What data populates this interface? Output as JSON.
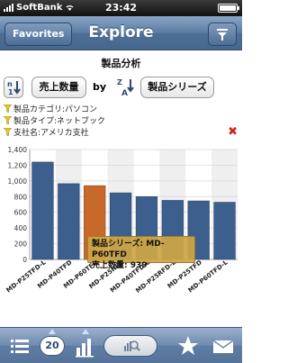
{
  "status_bar": {
    "carrier": "SoftBank",
    "time": "23:42"
  },
  "nav": {
    "back_label": "Favorites",
    "title": "Explore",
    "filter_icon": "filter-icon"
  },
  "heading": "製品分析",
  "sort": {
    "measure_label": "売上数量",
    "by_label": "by",
    "dimension_label": "製品シリーズ"
  },
  "filters": [
    {
      "label": "製品カテゴリ:パソコン"
    },
    {
      "label": "製品タイプ:ネットブック"
    },
    {
      "label": "支社名:アメリカ支社"
    }
  ],
  "tooltip": {
    "series_label": "製品シリーズ: MD-P60TFD",
    "qty_label": "売上数量: 939"
  },
  "toolbar": {
    "count": "20"
  },
  "colors": {
    "bar": "#3d5f8e",
    "highlight": "#c8692c",
    "nav": "#5a7ca3",
    "filter": "#e6c12a"
  },
  "chart_data": {
    "type": "bar",
    "categories": [
      "MD-P25TFD-L",
      "MD-P40TFD",
      "MD-P60TFD",
      "MD-P25RFD",
      "MD-P40TFD-L",
      "MD-P25RFD-L",
      "MD-P25TFD",
      "MD-P60TFD-L"
    ],
    "values": [
      1240,
      965,
      939,
      848,
      800,
      752,
      745,
      728
    ],
    "highlight_index": 2,
    "ylim": [
      0,
      1400
    ],
    "yticks": [
      "0",
      "200",
      "400",
      "600",
      "800",
      "1,000",
      "1,200",
      "1,400"
    ],
    "ytick_values": [
      0,
      200,
      400,
      600,
      800,
      1000,
      1200,
      1400
    ],
    "grid": true
  }
}
